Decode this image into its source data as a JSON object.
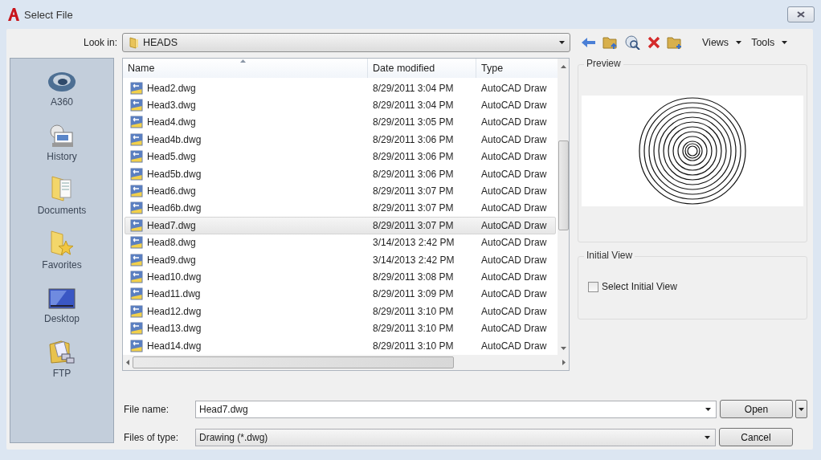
{
  "window": {
    "title": "Select File"
  },
  "look_in": {
    "label": "Look in:",
    "value": "HEADS"
  },
  "toolbar": {
    "views": "Views",
    "tools": "Tools"
  },
  "places": [
    {
      "label": "A360",
      "kind": "cloud"
    },
    {
      "label": "History",
      "kind": "history"
    },
    {
      "label": "Documents",
      "kind": "documents"
    },
    {
      "label": "Favorites",
      "kind": "favorites"
    },
    {
      "label": "Desktop",
      "kind": "desktop"
    },
    {
      "label": "FTP",
      "kind": "ftp"
    }
  ],
  "table": {
    "columns": [
      "Name",
      "Date modified",
      "Type"
    ],
    "rows": [
      {
        "name": "Head2.dwg",
        "date": "8/29/2011 3:04 PM",
        "type": "AutoCAD Draw",
        "selected": false
      },
      {
        "name": "Head3.dwg",
        "date": "8/29/2011 3:04 PM",
        "type": "AutoCAD Draw",
        "selected": false
      },
      {
        "name": "Head4.dwg",
        "date": "8/29/2011 3:05 PM",
        "type": "AutoCAD Draw",
        "selected": false
      },
      {
        "name": "Head4b.dwg",
        "date": "8/29/2011 3:06 PM",
        "type": "AutoCAD Draw",
        "selected": false
      },
      {
        "name": "Head5.dwg",
        "date": "8/29/2011 3:06 PM",
        "type": "AutoCAD Draw",
        "selected": false
      },
      {
        "name": "Head5b.dwg",
        "date": "8/29/2011 3:06 PM",
        "type": "AutoCAD Draw",
        "selected": false
      },
      {
        "name": "Head6.dwg",
        "date": "8/29/2011 3:07 PM",
        "type": "AutoCAD Draw",
        "selected": false
      },
      {
        "name": "Head6b.dwg",
        "date": "8/29/2011 3:07 PM",
        "type": "AutoCAD Draw",
        "selected": false
      },
      {
        "name": "Head7.dwg",
        "date": "8/29/2011 3:07 PM",
        "type": "AutoCAD Draw",
        "selected": true
      },
      {
        "name": "Head8.dwg",
        "date": "3/14/2013 2:42 PM",
        "type": "AutoCAD Draw",
        "selected": false
      },
      {
        "name": "Head9.dwg",
        "date": "3/14/2013 2:42 PM",
        "type": "AutoCAD Draw",
        "selected": false
      },
      {
        "name": "Head10.dwg",
        "date": "8/29/2011 3:08 PM",
        "type": "AutoCAD Draw",
        "selected": false
      },
      {
        "name": "Head11.dwg",
        "date": "8/29/2011 3:09 PM",
        "type": "AutoCAD Draw",
        "selected": false
      },
      {
        "name": "Head12.dwg",
        "date": "8/29/2011 3:10 PM",
        "type": "AutoCAD Draw",
        "selected": false
      },
      {
        "name": "Head13.dwg",
        "date": "8/29/2011 3:10 PM",
        "type": "AutoCAD Draw",
        "selected": false
      },
      {
        "name": "Head14.dwg",
        "date": "8/29/2011 3:10 PM",
        "type": "AutoCAD Draw",
        "selected": false
      }
    ]
  },
  "preview": {
    "title": "Preview"
  },
  "initial_view": {
    "title": "Initial View",
    "checkbox": {
      "label": "Select Initial View",
      "checked": false
    }
  },
  "file_name": {
    "label": "File name:",
    "value": "Head7.dwg"
  },
  "files_of_type": {
    "label": "Files of type:",
    "value": "Drawing (*.dwg)"
  },
  "buttons": {
    "open": "Open",
    "cancel": "Cancel"
  }
}
